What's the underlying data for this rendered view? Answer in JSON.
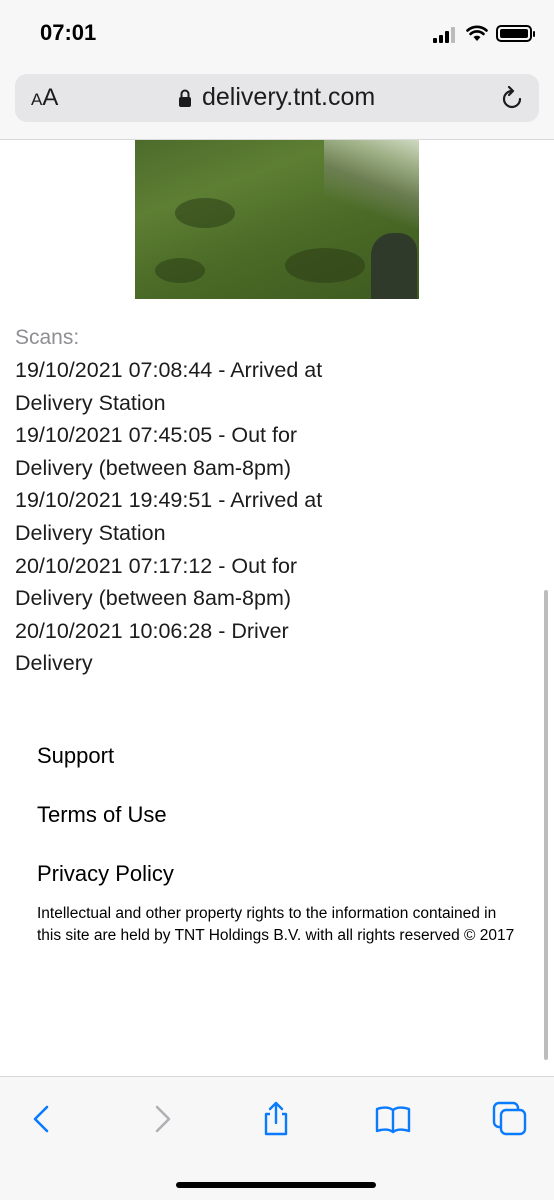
{
  "status_bar": {
    "time": "07:01"
  },
  "address_bar": {
    "text_size_button": "AA",
    "url": "delivery.tnt.com"
  },
  "scans": {
    "title": "Scans:",
    "entries": [
      "19/10/2021 07:08:44 - Arrived at Delivery Station",
      "19/10/2021 07:45:05 - Out for Delivery (between 8am-8pm)",
      "19/10/2021 19:49:51 - Arrived at Delivery Station",
      "20/10/2021 07:17:12 - Out for Delivery (between 8am-8pm)",
      "20/10/2021 10:06:28 - Driver Delivery"
    ]
  },
  "footer": {
    "links": [
      "Support",
      "Terms of Use",
      "Privacy Policy"
    ],
    "copyright": "Intellectual and other property rights to the information contained in this site are held by TNT Holdings B.V. with all rights reserved © 2017"
  },
  "icons": {
    "lock": "lock-icon",
    "reload": "reload-icon",
    "back": "back-arrow-icon",
    "forward": "forward-arrow-icon",
    "share": "share-icon",
    "bookmarks": "bookmarks-icon",
    "tabs": "tabs-icon"
  },
  "colors": {
    "accent": "#0a7aff",
    "disabled": "#b0b0b5",
    "secondary_text": "#8e8e93"
  }
}
